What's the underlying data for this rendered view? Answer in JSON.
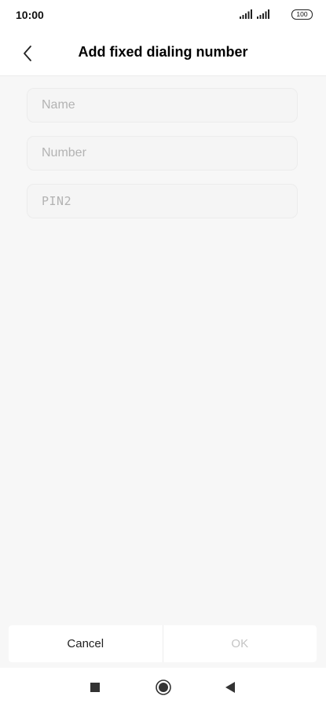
{
  "status_bar": {
    "time": "10:00",
    "battery": "100",
    "icons": [
      "signal-icon",
      "signal-icon",
      "battery-icon"
    ]
  },
  "header": {
    "title": "Add fixed dialing number",
    "back_icon": "chevron-left-icon"
  },
  "form": {
    "name_placeholder": "Name",
    "number_placeholder": "Number",
    "pin2_placeholder": "PIN2"
  },
  "actions": {
    "cancel_label": "Cancel",
    "ok_label": "OK"
  },
  "nav_bar": {
    "icons": [
      "recents-square-icon",
      "home-circle-icon",
      "back-triangle-icon"
    ]
  },
  "colors": {
    "background": "#f7f7f7",
    "surface": "#ffffff",
    "placeholder": "#b3b3b3",
    "disabled_text": "#c4c4c4"
  }
}
